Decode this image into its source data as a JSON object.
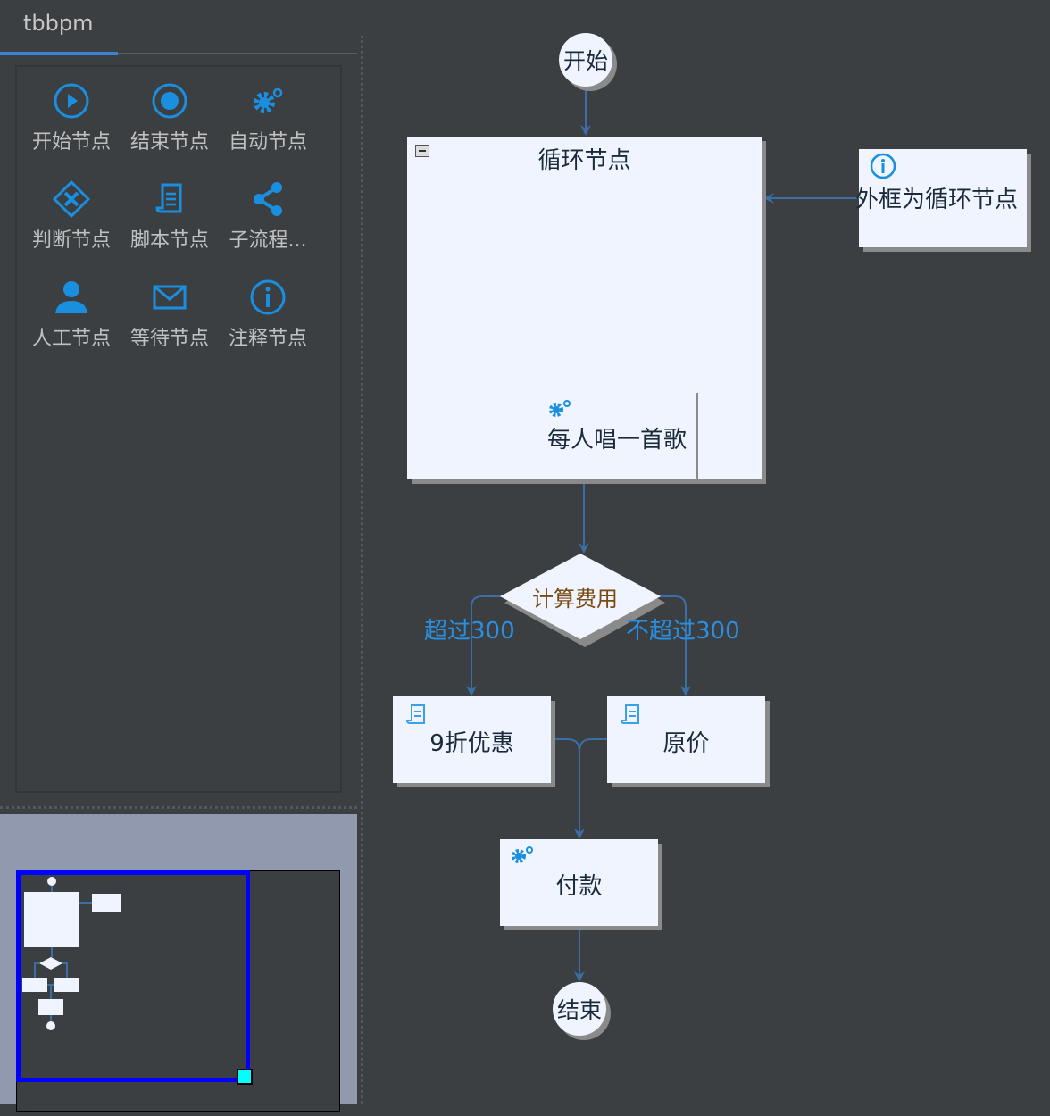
{
  "panel": {
    "tab_label": "tbbpm"
  },
  "palette": [
    {
      "label": "开始节点",
      "icon": "play-circle-icon"
    },
    {
      "label": "结束节点",
      "icon": "stop-circle-icon"
    },
    {
      "label": "自动节点",
      "icon": "gears-icon"
    },
    {
      "label": "判断节点",
      "icon": "diamond-icon"
    },
    {
      "label": "脚本节点",
      "icon": "scroll-icon"
    },
    {
      "label": "子流程...",
      "icon": "share-icon"
    },
    {
      "label": "人工节点",
      "icon": "user-icon"
    },
    {
      "label": "等待节点",
      "icon": "envelope-icon"
    },
    {
      "label": "注释节点",
      "icon": "info-icon"
    }
  ],
  "diagram": {
    "start": "开始",
    "loop": "循环节点",
    "loop_inner": "每人唱一首歌",
    "annotation": "外框为循环节点",
    "decision": "计算费用",
    "edge_over": "超过300",
    "edge_not_over": "不超过300",
    "discount": "9折优惠",
    "original": "原价",
    "pay": "付款",
    "end": "结束"
  },
  "colors": {
    "accent": "#2a8fe0",
    "edge": "#3a6ea5",
    "viewport": "#0000ff"
  }
}
